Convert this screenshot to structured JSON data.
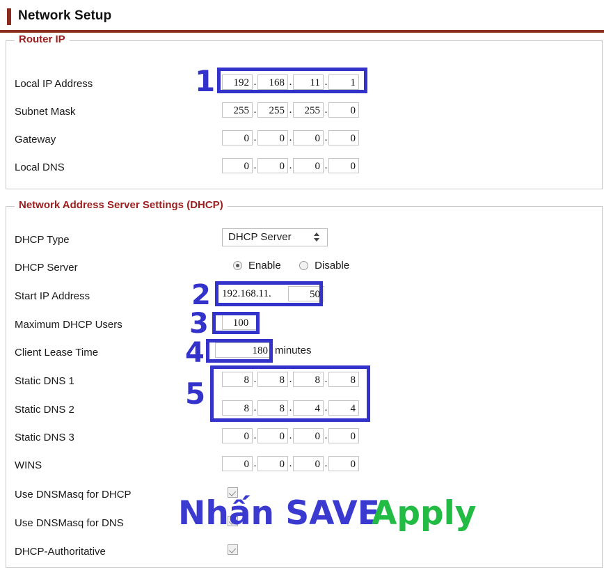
{
  "page": {
    "title": "Network Setup",
    "accent_color": "#8c2b20",
    "annotation_color": "#3333cc"
  },
  "router_ip": {
    "legend": "Router IP",
    "rows": [
      {
        "label": "Local IP Address",
        "octets": [
          "192",
          "168",
          "11",
          "1"
        ]
      },
      {
        "label": "Subnet Mask",
        "octets": [
          "255",
          "255",
          "255",
          "0"
        ]
      },
      {
        "label": "Gateway",
        "octets": [
          "0",
          "0",
          "0",
          "0"
        ]
      },
      {
        "label": "Local DNS",
        "octets": [
          "0",
          "0",
          "0",
          "0"
        ]
      }
    ]
  },
  "dhcp": {
    "legend": "Network Address Server Settings (DHCP)",
    "dhcp_type_label": "DHCP Type",
    "dhcp_type_value": "DHCP Server",
    "dhcp_server_label": "DHCP Server",
    "enable_label": "Enable",
    "disable_label": "Disable",
    "start_ip_label": "Start IP Address",
    "start_ip_prefix": "192.168.11.",
    "start_ip_value": "50",
    "max_users_label": "Maximum DHCP Users",
    "max_users_value": "100",
    "lease_label": "Client Lease Time",
    "lease_value": "180",
    "lease_suffix": "minutes",
    "static_dns_1_label": "Static DNS 1",
    "static_dns_1": [
      "8",
      "8",
      "8",
      "8"
    ],
    "static_dns_2_label": "Static DNS 2",
    "static_dns_2": [
      "8",
      "8",
      "4",
      "4"
    ],
    "static_dns_3_label": "Static DNS 3",
    "static_dns_3": [
      "0",
      "0",
      "0",
      "0"
    ],
    "wins_label": "WINS",
    "wins": [
      "0",
      "0",
      "0",
      "0"
    ],
    "dnsmasq_dhcp_label": "Use DNSMasq for DHCP",
    "dnsmasq_dns_label": "Use DNSMasq for DNS",
    "dhcp_authoritative_label": "DHCP-Authoritative"
  },
  "annotations": {
    "n1": "1",
    "n2": "2",
    "n3": "3",
    "n4": "4",
    "n5": "5",
    "overlay_save": "Nhấn SAVE",
    "overlay_apply": "Apply",
    "overlay_save_color": "#3a3ad0",
    "overlay_apply_color": "#22bb44"
  }
}
